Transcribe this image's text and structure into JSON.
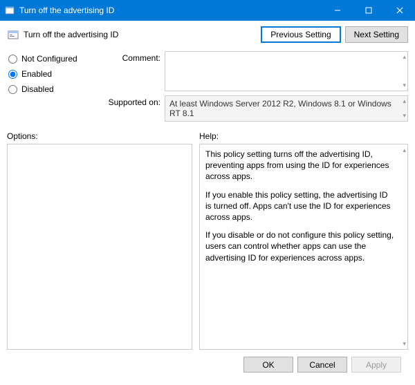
{
  "titlebar": {
    "title": "Turn off the advertising ID"
  },
  "header": {
    "title": "Turn off the advertising ID",
    "previous_label": "Previous Setting",
    "next_label": "Next Setting"
  },
  "config": {
    "not_configured_label": "Not Configured",
    "enabled_label": "Enabled",
    "disabled_label": "Disabled",
    "selected": "enabled",
    "comment_label": "Comment:",
    "comment_value": "",
    "supported_label": "Supported on:",
    "supported_value": "At least Windows Server 2012 R2, Windows 8.1 or Windows RT 8.1"
  },
  "panes": {
    "options_label": "Options:",
    "help_label": "Help:",
    "help_p1": "This policy setting turns off the advertising ID, preventing apps from using the ID for experiences across apps.",
    "help_p2": "If you enable this policy setting, the advertising ID is turned off. Apps can't use the ID for experiences across apps.",
    "help_p3": "If you disable or do not configure this policy setting, users can control whether apps can use the advertising ID for experiences across apps."
  },
  "footer": {
    "ok_label": "OK",
    "cancel_label": "Cancel",
    "apply_label": "Apply"
  }
}
